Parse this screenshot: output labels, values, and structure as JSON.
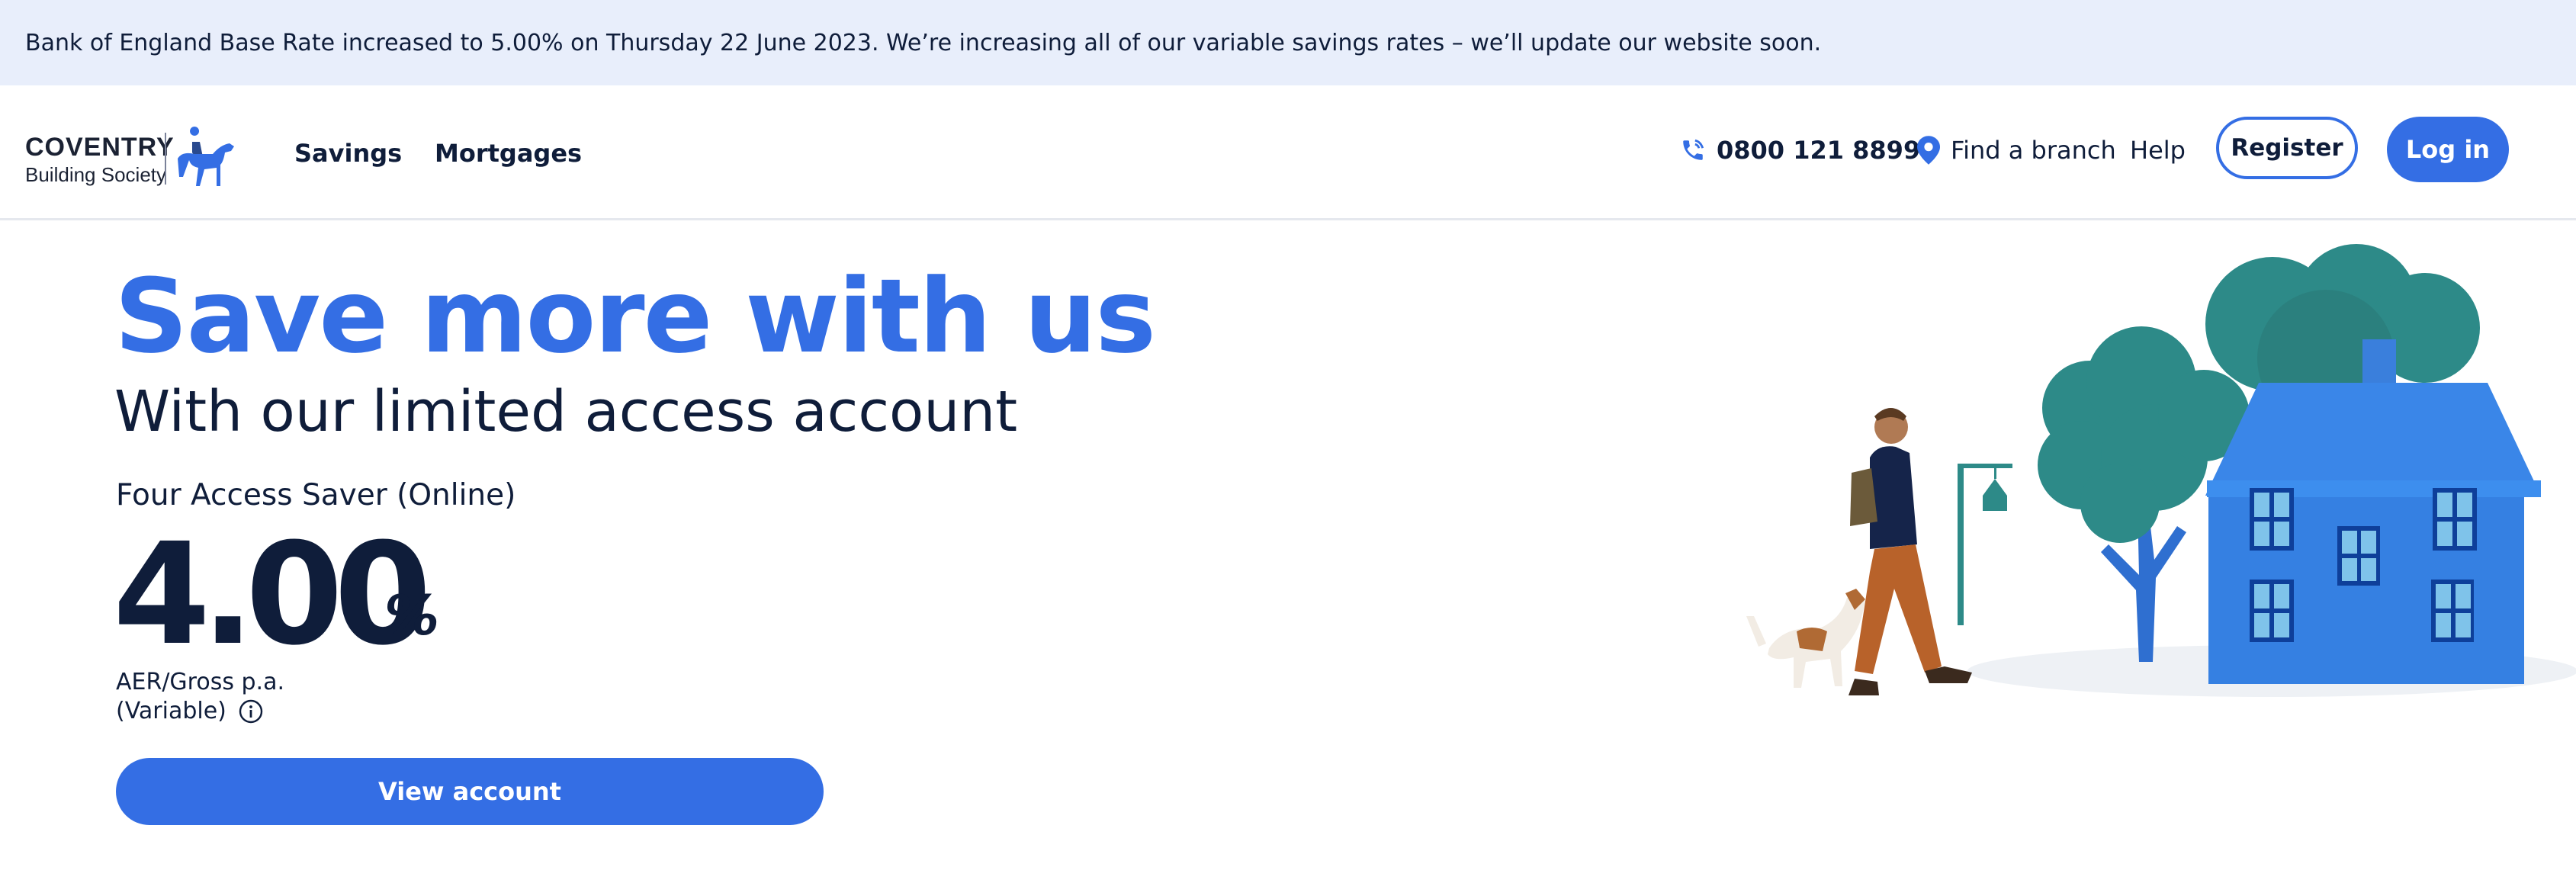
{
  "banner": {
    "text": "Bank of England Base Rate increased to 5.00% on Thursday 22 June 2023. We’re increasing all of our variable savings rates – we’ll update our website soon."
  },
  "logo": {
    "line1": "COVENTRY",
    "line2": "Building Society"
  },
  "nav": {
    "links": [
      "Savings",
      "Mortgages"
    ],
    "phone": "0800 121 8899",
    "find_branch": "Find a branch",
    "help": "Help",
    "register": "Register",
    "login": "Log in"
  },
  "hero": {
    "title": "Save more with us",
    "subtitle": "With our limited access account",
    "product_name": "Four Access Saver (Online)",
    "rate": "4.00",
    "rate_unit": "%",
    "aer": "AER/Gross p.a.",
    "variable": "(Variable)",
    "cta": "View account"
  },
  "colors": {
    "accent": "#346ee4",
    "banner_bg": "#e8eefb",
    "text": "#0f1d3a"
  }
}
